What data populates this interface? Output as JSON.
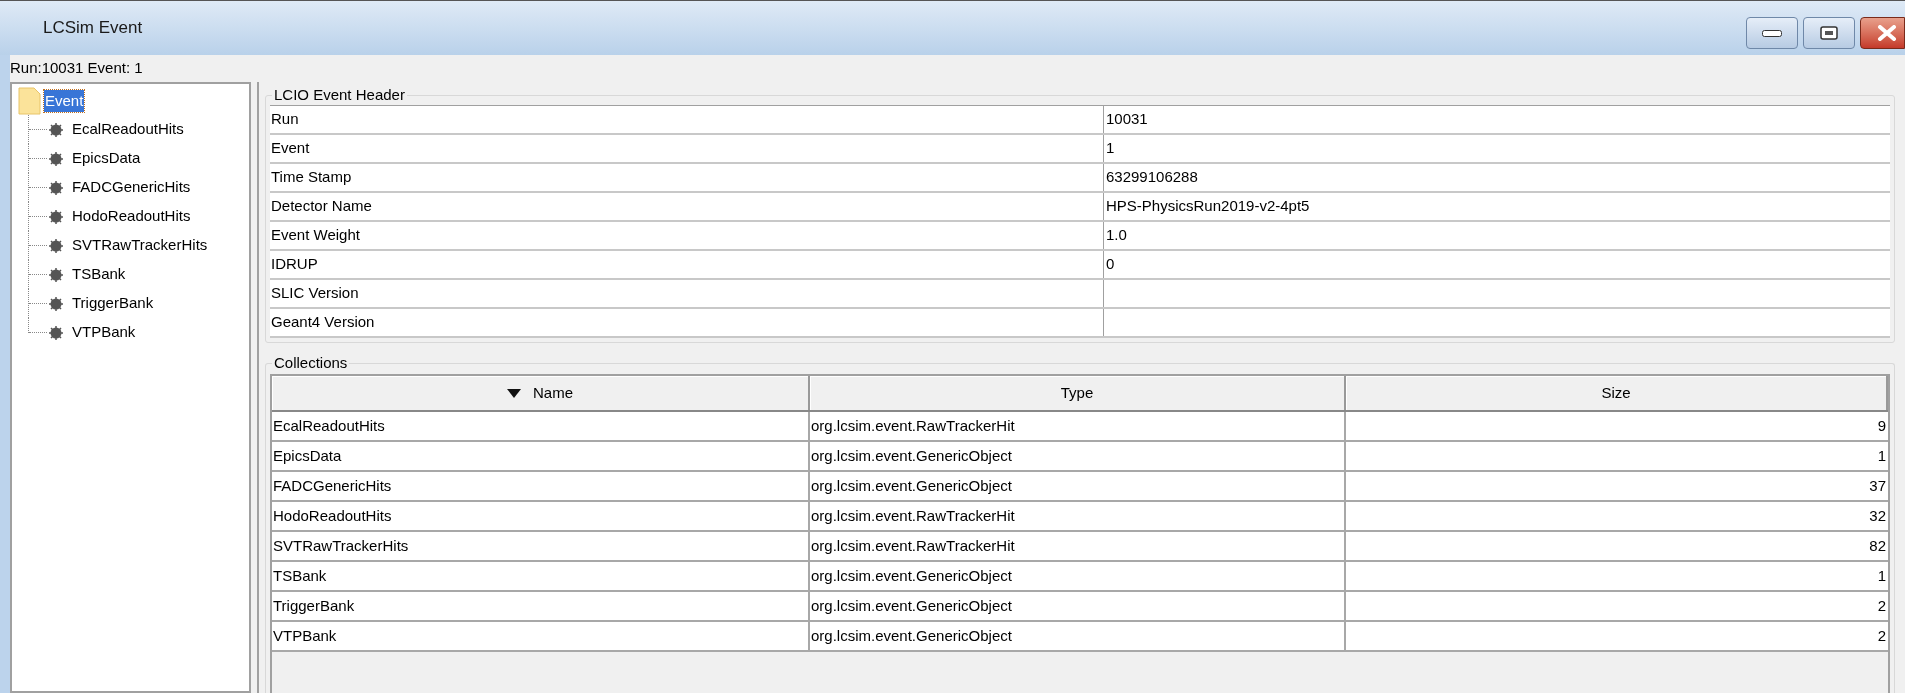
{
  "window": {
    "title": "LCSim Event"
  },
  "run_line": "Run:10031  Event: 1",
  "tree": {
    "label": "Event",
    "selected": true,
    "children": [
      {
        "label": "EcalReadoutHits",
        "selected": false
      },
      {
        "label": "EpicsData",
        "selected": false
      },
      {
        "label": "FADCGenericHits",
        "selected": false
      },
      {
        "label": "HodoReadoutHits",
        "selected": false
      },
      {
        "label": "SVTRawTrackerHits",
        "selected": false
      },
      {
        "label": "TSBank",
        "selected": false
      },
      {
        "label": "TriggerBank",
        "selected": false
      },
      {
        "label": "VTPBank",
        "selected": false
      }
    ]
  },
  "event_header": {
    "title": "LCIO Event Header",
    "rows": [
      {
        "name": "Run",
        "value": "10031"
      },
      {
        "name": "Event",
        "value": "1"
      },
      {
        "name": "Time Stamp",
        "value": "63299106288"
      },
      {
        "name": "Detector Name",
        "value": "HPS-PhysicsRun2019-v2-4pt5"
      },
      {
        "name": "Event Weight",
        "value": "1.0"
      },
      {
        "name": "IDRUP",
        "value": "0"
      },
      {
        "name": "SLIC Version"
      },
      {
        "name": "Geant4 Version"
      }
    ]
  },
  "collections": {
    "title": "Collections",
    "columns": [
      {
        "label": "Name",
        "sorted_descending": true
      },
      {
        "label": "Type",
        "sorted_descending": false
      },
      {
        "label": "Size",
        "sorted_descending": false
      }
    ],
    "rows": [
      [
        "EcalReadoutHits",
        "org.lcsim.event.RawTrackerHit",
        "9"
      ],
      [
        "EpicsData",
        "org.lcsim.event.GenericObject",
        "1"
      ],
      [
        "FADCGenericHits",
        "org.lcsim.event.GenericObject",
        "37"
      ],
      [
        "HodoReadoutHits",
        "org.lcsim.event.RawTrackerHit",
        "32"
      ],
      [
        "SVTRawTrackerHits",
        "org.lcsim.event.RawTrackerHit",
        "82"
      ],
      [
        "TSBank",
        "org.lcsim.event.GenericObject",
        "1"
      ],
      [
        "TriggerBank",
        "org.lcsim.event.GenericObject",
        "2"
      ],
      [
        "VTPBank",
        "org.lcsim.event.GenericObject",
        "2"
      ]
    ]
  }
}
